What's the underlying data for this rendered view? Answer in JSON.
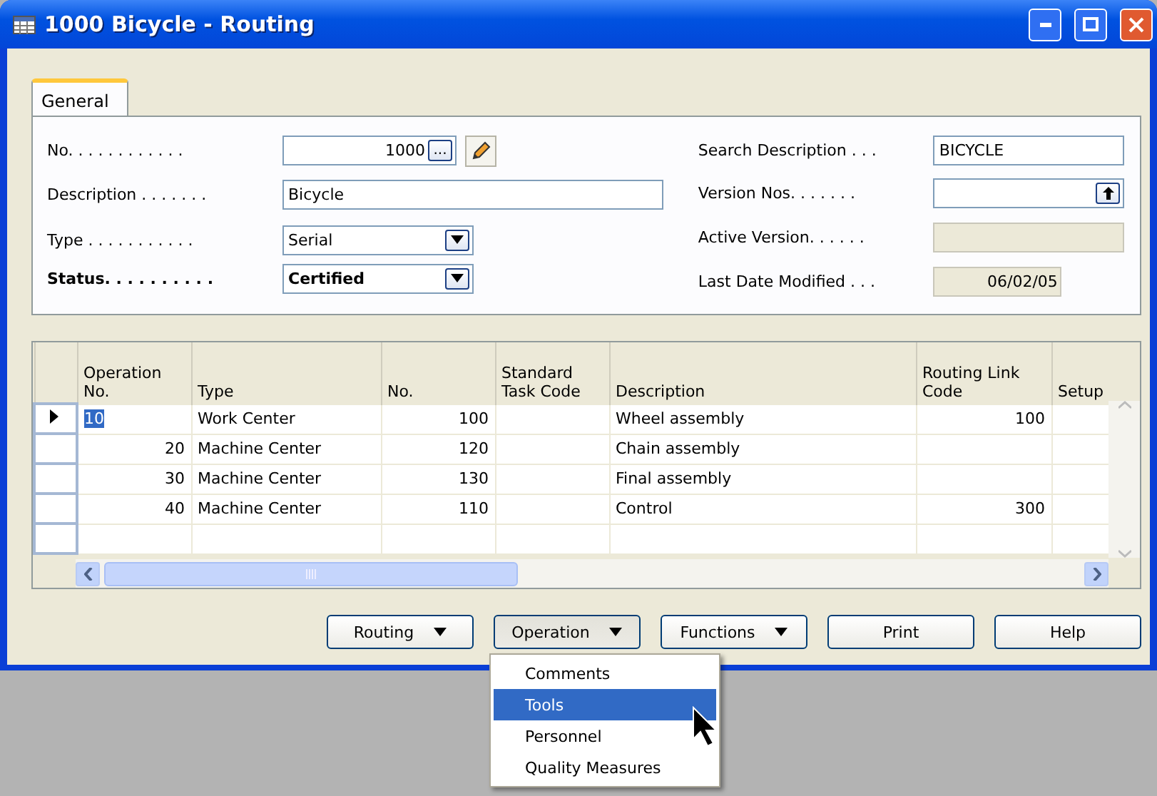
{
  "window": {
    "title": "1000 Bicycle - Routing"
  },
  "tabs": [
    {
      "label": "General",
      "selected": true
    }
  ],
  "left_fields": [
    {
      "label": "No. . . . . . . . . . . .",
      "value": "1000",
      "kind": "assist",
      "assist": "...",
      "bold": false
    },
    {
      "label": "Description . . . . . . .",
      "value": "Bicycle",
      "kind": "text",
      "bold": false
    },
    {
      "label": "Type . . . . . . . . . . .",
      "value": "Serial",
      "kind": "dropdown",
      "bold": false
    },
    {
      "label": "Status. . . . . . . . . .",
      "value": "Certified",
      "kind": "dropdown",
      "bold": true
    }
  ],
  "right_fields": [
    {
      "label": "Search Description . . .",
      "value": "BICYCLE",
      "kind": "text",
      "disabled": false
    },
    {
      "label": "Version Nos. . . . . . .",
      "kind": "lookup",
      "disabled": false
    },
    {
      "label": "Active Version. . . . . .",
      "kind": "text",
      "disabled": true
    },
    {
      "label": "Last Date Modified . . .",
      "value": "06/02/05",
      "kind": "date",
      "disabled": true
    }
  ],
  "table": {
    "columns": [
      {
        "label": "Operation No.",
        "kind": "number"
      },
      {
        "label": "Type",
        "kind": "text"
      },
      {
        "label": "No.",
        "kind": "number"
      },
      {
        "label": "Standard Task Code",
        "kind": "text"
      },
      {
        "label": "Description",
        "kind": "text"
      },
      {
        "label": "Routing Link Code",
        "kind": "number"
      },
      {
        "label": "Setup",
        "kind": "text"
      }
    ],
    "rows": [
      {
        "current": true,
        "cells": [
          "10",
          "Work Center",
          "100",
          "",
          "Wheel assembly",
          "100",
          ""
        ]
      },
      {
        "current": false,
        "cells": [
          "20",
          "Machine Center",
          "120",
          "",
          "Chain assembly",
          "",
          ""
        ]
      },
      {
        "current": false,
        "cells": [
          "30",
          "Machine Center",
          "130",
          "",
          "Final assembly",
          "",
          ""
        ]
      },
      {
        "current": false,
        "cells": [
          "40",
          "Machine Center",
          "110",
          "",
          "Control",
          "300",
          ""
        ]
      }
    ]
  },
  "buttons": [
    {
      "label": "Routing",
      "kind": "menu",
      "expanded": false
    },
    {
      "label": "Operation",
      "kind": "menu",
      "expanded": true
    },
    {
      "label": "Functions",
      "kind": "menu",
      "expanded": false
    },
    {
      "label": "Print",
      "kind": "plain",
      "expanded": false
    },
    {
      "label": "Help",
      "kind": "plain",
      "expanded": false
    }
  ],
  "menu": {
    "items": [
      {
        "label": "Comments",
        "selected": false
      },
      {
        "label": "Tools",
        "selected": true
      },
      {
        "label": "Personnel",
        "selected": false
      },
      {
        "label": "Quality Measures",
        "selected": false
      }
    ]
  }
}
